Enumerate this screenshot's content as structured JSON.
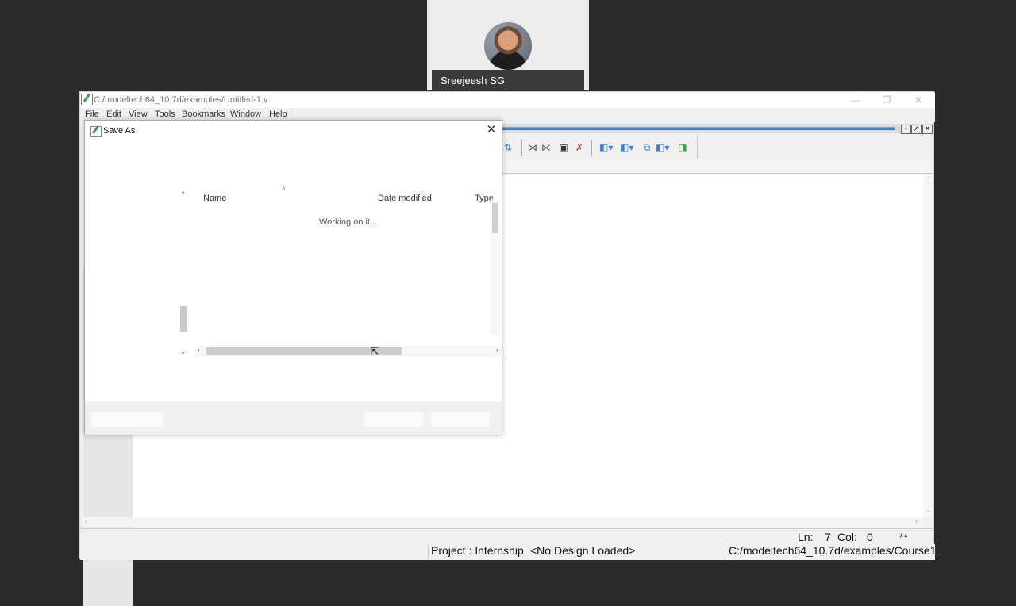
{
  "participant": {
    "name": "Sreejeesh SG"
  },
  "window": {
    "title": "C:/modeltech64_10.7d/examples/Untitled-1.v",
    "controls": {
      "minimize": "—",
      "restore": "❐",
      "close": "✕"
    }
  },
  "menu": [
    "File",
    "Edit",
    "View",
    "Tools",
    "Bookmarks",
    "Window",
    "Help"
  ],
  "dock": {
    "buttons": [
      "+",
      "↗",
      "✕"
    ]
  },
  "toolbar": {
    "icons": [
      "compile-all-icon",
      "compile-out-of-date-icon",
      "compile-icon",
      "break-icon",
      "simulate-icon",
      "add-wave-icon",
      "add-list-icon",
      "zoom-icon",
      "step-icon"
    ]
  },
  "dialog": {
    "title": "Save As",
    "close": "✕",
    "columns": {
      "name": "Name",
      "date": "Date modified",
      "type": "Type"
    },
    "sort_indicator": "^",
    "status": "Working on it..."
  },
  "statusline": {
    "ln_label": "Ln:",
    "ln": "7",
    "col_label": "Col:",
    "col": "0",
    "modified": "**"
  },
  "bottombar": {
    "project": "Project : Internship",
    "design": "<No Design Loaded>",
    "path": "C:/modeltech64_10.7d/examples/Course1"
  }
}
